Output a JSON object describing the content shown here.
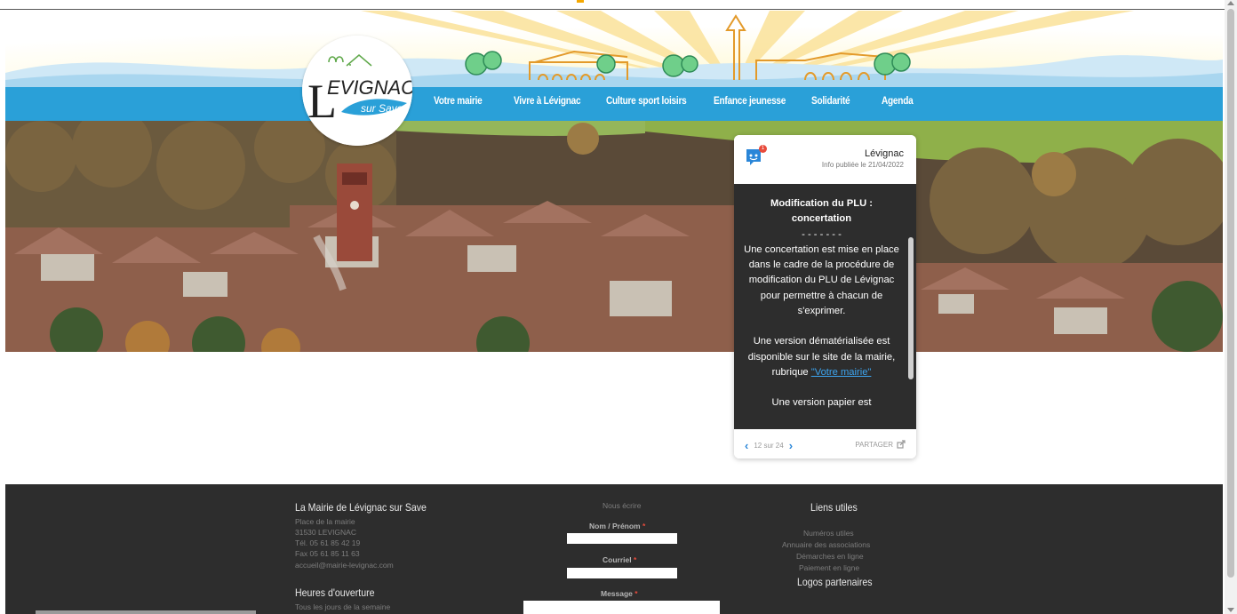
{
  "logo": {
    "text_main": "EVIGNAC",
    "text_initial": "L",
    "text_sub": "sur Save"
  },
  "nav": {
    "items": [
      {
        "label": "Votre mairie"
      },
      {
        "label": "Vivre à Lévignac"
      },
      {
        "label": "Culture sport loisirs"
      },
      {
        "label": "Enfance jeunesse"
      },
      {
        "label": "Solidarité"
      },
      {
        "label": "Agenda"
      }
    ]
  },
  "widget": {
    "source_name": "Lévignac",
    "published": "Info publiée le 21/04/2022",
    "badge": "1",
    "title_line1": "Modification du PLU :",
    "title_line2": "concertation",
    "separator": "- - - - - - -",
    "paragraph1": "Une concertation est mise en place dans le cadre de la procédure de modification du PLU de Lévignac pour permettre à chacun de s'exprimer.",
    "paragraph2_before_link": "Une version dématérialisée est disponible sur le site de la mairie, rubrique ",
    "paragraph2_link": "\"Votre mairie\"",
    "paragraph3_partial": "Une version papier est",
    "pager": "12 sur 24",
    "share_label": "PARTAGER"
  },
  "footer": {
    "contact": {
      "heading": "La Mairie de Lévignac sur Save",
      "lines": [
        "Place de la mairie",
        "31530 LEVIGNAC",
        "Tél. 05 61 85 42 19",
        "Fax 05 61 85 11 63",
        "accueil@mairie-levignac.com"
      ]
    },
    "hours": {
      "heading": "Heures d'ouverture",
      "line1": "Tous les jours de la semaine"
    },
    "form": {
      "heading": "Nous écrire",
      "name_label": "Nom / Prénom",
      "email_label": "Courriel",
      "message_label": "Message",
      "required_mark": "*"
    },
    "links": {
      "heading": "Liens utiles",
      "items": [
        "Numéros utiles",
        "Annuaire des associations",
        "Démarches en ligne",
        "Paiement en ligne"
      ],
      "partners_heading": "Logos partenaires"
    }
  },
  "colors": {
    "nav_blue": "#2aa0d8",
    "footer_bg": "#2d2d2d",
    "widget_body": "#2d2d2d",
    "link_blue": "#3da5f0",
    "required_red": "#e84b3c"
  }
}
